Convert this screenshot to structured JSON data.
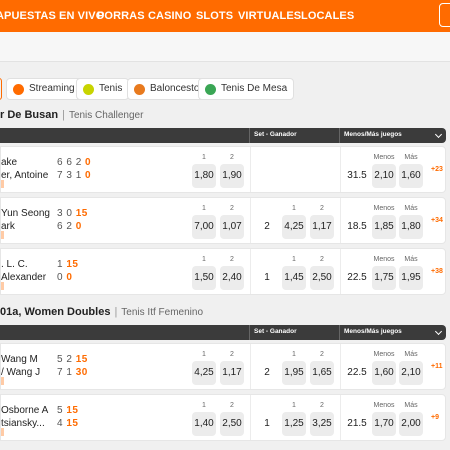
{
  "nav": {
    "items": [
      "APUESTAS EN VIVO",
      "PORRAS",
      "CASINO",
      "SLOTS",
      "VIRTUALES",
      "LOCALES"
    ]
  },
  "filters": [
    {
      "label": "Streaming",
      "icon": "play-icon",
      "color": "#ff6b00"
    },
    {
      "label": "Tenis",
      "icon": "tennis-ball-icon",
      "color": "#c8d400"
    },
    {
      "label": "Baloncesto",
      "icon": "basketball-icon",
      "color": "#e87a1e"
    },
    {
      "label": "Tenis De Mesa",
      "icon": "table-tennis-icon",
      "color": "#3aa655"
    }
  ],
  "leagues": [
    {
      "name": "r De Busan",
      "category": "Tenis Challenger",
      "headers": {
        "set_winner": "Set - Ganador",
        "totals": "Menos/Más juegos"
      },
      "events": [
        {
          "p1": "ake",
          "p2": "er, Antoine",
          "s1": [
            "6",
            "6",
            "2"
          ],
          "s2": [
            "7",
            "3",
            "1"
          ],
          "pt1": "0",
          "pt2": "0",
          "ml": [
            "1,80",
            "1,90"
          ],
          "set": null,
          "totals": {
            "line": "31.5",
            "under": "2,10",
            "over": "1,60"
          },
          "more": "+23"
        },
        {
          "p1": "Yun Seong",
          "p2": "ark",
          "s1": [
            "3",
            "0"
          ],
          "s2": [
            "6",
            "2"
          ],
          "pt1": "15",
          "pt2": "0",
          "ml": [
            "7,00",
            "1,07"
          ],
          "set": {
            "num": "2",
            "odds": [
              "4,25",
              "1,17"
            ]
          },
          "totals": {
            "line": "18.5",
            "under": "1,85",
            "over": "1,80"
          },
          "more": "+34"
        },
        {
          "p1": ". L. C.",
          "p2": "Alexander",
          "s1": [
            "1"
          ],
          "s2": [
            "0"
          ],
          "pt1": "15",
          "pt2": "0",
          "ml": [
            "1,50",
            "2,40"
          ],
          "set": {
            "num": "1",
            "odds": [
              "1,45",
              "2,50"
            ]
          },
          "totals": {
            "line": "22.5",
            "under": "1,75",
            "over": "1,95"
          },
          "more": "+38"
        }
      ]
    },
    {
      "name": "01a, Women Doubles",
      "category": "Tenis Itf Femenino",
      "headers": {
        "set_winner": "Set - Ganador",
        "totals": "Menos/Más juegos"
      },
      "events": [
        {
          "p1": "Wang M",
          "p2": "/ Wang J",
          "s1": [
            "5",
            "2"
          ],
          "s2": [
            "7",
            "1"
          ],
          "pt1": "15",
          "pt2": "30",
          "ml": [
            "4,25",
            "1,17"
          ],
          "set": {
            "num": "2",
            "odds": [
              "1,95",
              "1,65"
            ]
          },
          "totals": {
            "line": "22.5",
            "under": "1,60",
            "over": "2,10"
          },
          "more": "+11"
        },
        {
          "p1": "Osborne A",
          "p2": "tsiansky...",
          "s1": [
            "5"
          ],
          "s2": [
            "4"
          ],
          "pt1": "15",
          "pt2": "15",
          "ml": [
            "1,40",
            "2,50"
          ],
          "set": {
            "num": "1",
            "odds": [
              "1,25",
              "3,25"
            ]
          },
          "totals": {
            "line": "21.5",
            "under": "1,70",
            "over": "2,00"
          },
          "more": "+9"
        }
      ]
    }
  ],
  "labels": {
    "one": "1",
    "two": "2",
    "under": "Menos",
    "over": "Más"
  },
  "colors": {
    "brand": "#ff6b00",
    "header_bar": "#3b3b3b"
  }
}
